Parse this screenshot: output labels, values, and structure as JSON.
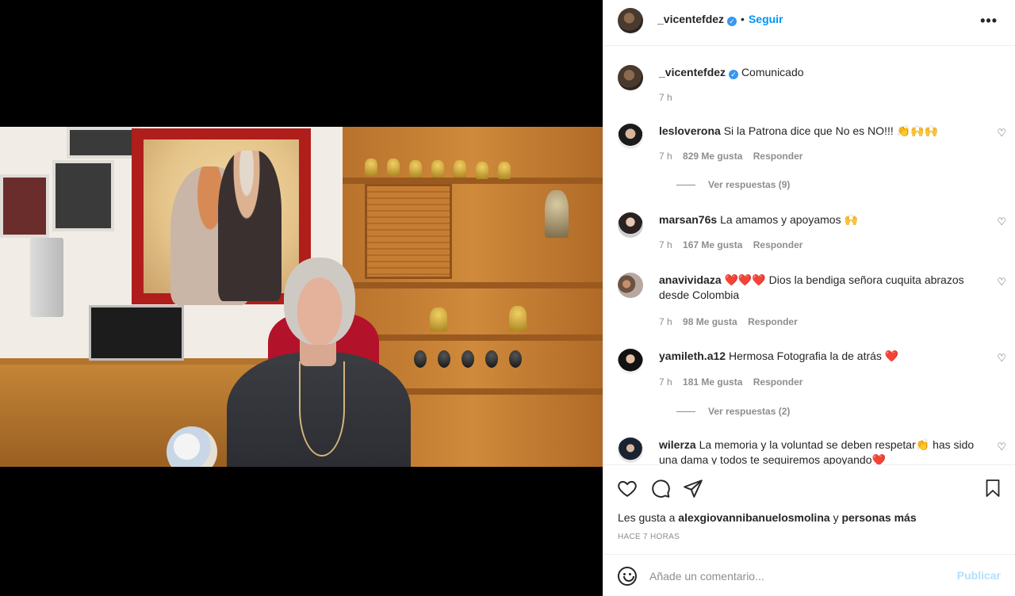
{
  "post": {
    "author": "_vicentefdez",
    "follow_label": "Seguir",
    "more_label": "•••",
    "verified_badge": "✓",
    "dot": "•"
  },
  "caption": {
    "username": "_vicentefdez",
    "text": "Comunicado",
    "time": "7 h"
  },
  "comments": [
    {
      "username": "lesloverona",
      "text": "Si la Patrona dice que No es NO!!! 👏🙌🙌",
      "time": "7 h",
      "likes": "829 Me gusta",
      "reply": "Responder",
      "replies": "Ver respuestas (9)"
    },
    {
      "username": "marsan76s",
      "text": "La amamos y apoyamos 🙌",
      "time": "7 h",
      "likes": "167 Me gusta",
      "reply": "Responder"
    },
    {
      "username": "anavividaza",
      "text": "❤️❤️❤️ Dios la bendiga señora cuquita abrazos desde Colombia",
      "time": "7 h",
      "likes": "98 Me gusta",
      "reply": "Responder"
    },
    {
      "username": "yamileth.a12",
      "text": "Hermosa Fotografia la de atrás ❤️",
      "time": "7 h",
      "likes": "181 Me gusta",
      "reply": "Responder",
      "replies": "Ver respuestas (2)"
    },
    {
      "username": "wilerza",
      "text": "La memoria y la voluntad se deben respetar👏 has sido una dama y todos te seguiremos apoyando❤️"
    }
  ],
  "icons": {
    "like": "heart-icon",
    "comment": "comment-icon",
    "share": "share-icon",
    "save": "bookmark-icon",
    "comment_like": "♡"
  },
  "likes_line": {
    "prefix": "Les gusta a",
    "user": "alexgiovannibanuelosmolina",
    "conj": "y",
    "others": "personas más"
  },
  "timestamp": "HACE 7 HORAS",
  "composer": {
    "placeholder": "Añade un comentario...",
    "publish_label": "Publicar"
  },
  "colors": {
    "accent": "#0095f6",
    "publish_disabled": "#b2dffc",
    "muted": "#8e8e8e"
  }
}
